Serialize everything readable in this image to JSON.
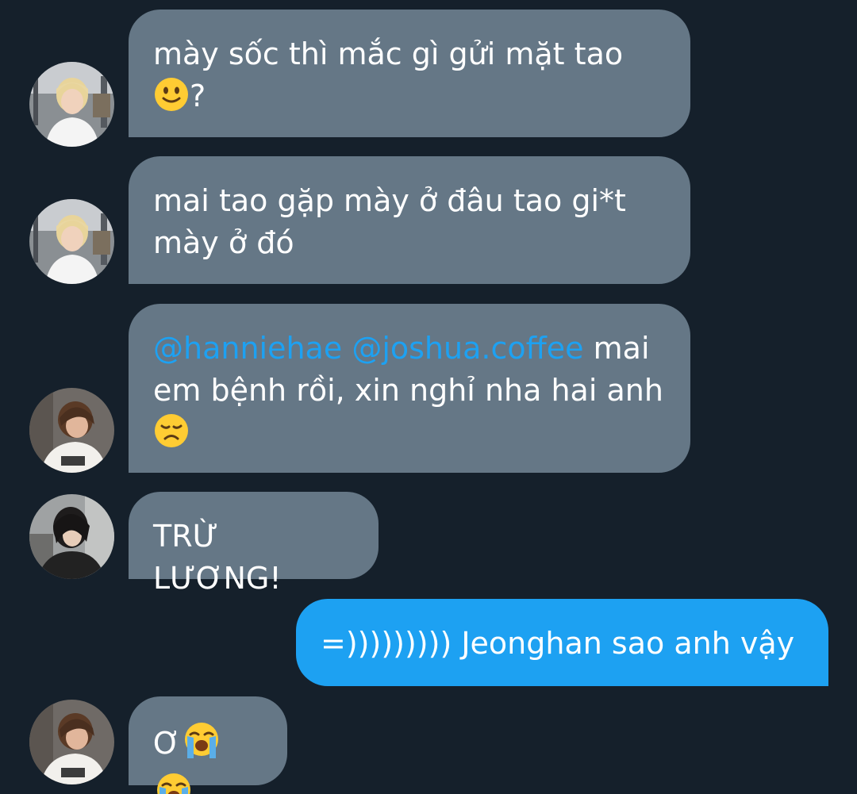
{
  "messages": [
    {
      "direction": "incoming",
      "avatar": "blonde-boy-avatar",
      "text_parts": [
        "mày sốc thì mắc gì gửi mặt tao",
        "?"
      ],
      "emoji": [
        "slightly-smiling-face"
      ]
    },
    {
      "direction": "incoming",
      "avatar": "blonde-boy-avatar",
      "lines": [
        "mai tao gặp mày ở đâu tao gi*t",
        "mày ở đó"
      ]
    },
    {
      "direction": "incoming",
      "avatar": "brown-hair-boy-avatar",
      "mentions": [
        "@hanniehae",
        "@joshua.coffee"
      ],
      "text_parts": [
        "mai",
        "em bệnh rồi, xin nghỉ nha hai anh"
      ],
      "emoji": [
        "disappointed-face"
      ]
    },
    {
      "direction": "incoming",
      "avatar": "dark-hair-boy-avatar",
      "text": "TRỪ LƯƠNG!"
    },
    {
      "direction": "outgoing",
      "text": "=))))))))) Jeonghan sao anh vậy"
    },
    {
      "direction": "incoming",
      "avatar": "brown-hair-boy-avatar",
      "text": "Ơ",
      "emoji": [
        "loudly-crying-face",
        "loudly-crying-face"
      ]
    }
  ],
  "colors": {
    "background": "#15202b",
    "incoming_bubble": "#657786",
    "outgoing_bubble": "#1da1f2",
    "mention": "#1da1f2",
    "text": "#ffffff"
  }
}
